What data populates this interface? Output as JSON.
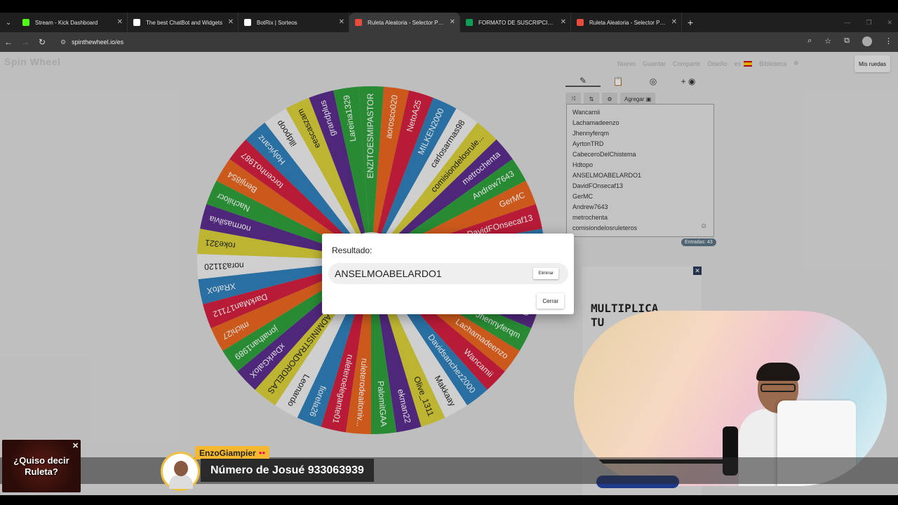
{
  "browser": {
    "tabs": [
      {
        "label": "Stream - Kick Dashboard",
        "color": "#53fc18",
        "active": false
      },
      {
        "label": "The best ChatBot and Widgets",
        "color": "#ffffff",
        "active": false
      },
      {
        "label": "BotRix | Sorteos",
        "color": "#ffffff",
        "active": false
      },
      {
        "label": "Ruleta Aleatoria - Selector Perso",
        "color": "#e94b3c",
        "active": true
      },
      {
        "label": "FORMATO DE SUSCRIPCION SO",
        "color": "#0f9d58",
        "active": false
      },
      {
        "label": "Ruleta Aleatoria - Selector Perso",
        "color": "#e94b3c",
        "active": false
      }
    ],
    "url": "spinthewheel.io/es"
  },
  "site": {
    "logo": "Spin Wheel",
    "nav": [
      "Nuevo",
      "Guardar",
      "Compartir",
      "Diseño",
      "es",
      "Biblioteca"
    ],
    "mis_ruedas": "Mis ruedas"
  },
  "wheel": {
    "labels": [
      "ENZITOESMIPASTOR",
      "aorosco020",
      "NetoA25",
      "MILKEN2000",
      "carlosarmas98",
      "comisiondelosrule...",
      "metrochenta",
      "Andrew7643",
      "GerMC",
      "DavidFOnsecaf13",
      "CabeceroDelChistema",
      "Hdtopo",
      "ANSELMOABELARDO1",
      "AyrtonTRD",
      "Jhennyferqm",
      "Lachamadeenzo",
      "Wancamii",
      "Davidsanchez2000",
      "Makkaay",
      "Olive_1311",
      "ekman22",
      "PalomitGAA",
      "ruleterodeaitoniv...",
      "ruleteroelegante01",
      "fiorela26",
      "Leonardo",
      "ADMINISTRADORDELAS",
      "xDarkGaloX",
      "jonathan1989",
      "michi27",
      "DarkMan17112",
      "XRafoX",
      "nora31120",
      "roke321",
      "normasilvia",
      "Nachilocr",
      "Benji854",
      "torcenho1987",
      "Holyicanz",
      "illdpoop",
      "eescaszam",
      "grandplus",
      "Lareina1329"
    ],
    "colors": [
      "#2e9e3b",
      "#e8661f",
      "#d11f3e",
      "#2f7fb8",
      "#ececec",
      "#d8cf3a",
      "#5b2d8b",
      "#2e9e3b",
      "#e8661f",
      "#d11f3e",
      "#2f7fb8",
      "#ececec",
      "#d8cf3a",
      "#5b2d8b"
    ]
  },
  "editor": {
    "agregar": "Agregar",
    "entries": [
      "Wancamii",
      "Lachamadeenzo",
      "Jhennyferqm",
      "AyrtonTRD",
      "CabeceroDelChistema",
      "Hdtopo",
      "ANSELMOABELARDO1",
      "DavidFOnsecaf13",
      "GerMC",
      "Andrew7643",
      "metrochenta",
      "comisiondelosruleteros"
    ],
    "count": "Entradas: 43"
  },
  "modal": {
    "title": "Resultado:",
    "result": "ANSELMOABELARDO1",
    "eliminar": "Eliminar",
    "cerrar": "Cerrar"
  },
  "ad": {
    "text": "MULTIPLICA\nTU"
  },
  "overlay": {
    "promo": "¿Quiso decir Ruleta?",
    "chat_name": "EnzoGiampier",
    "chat_message": "Número de Josué 933063939"
  }
}
